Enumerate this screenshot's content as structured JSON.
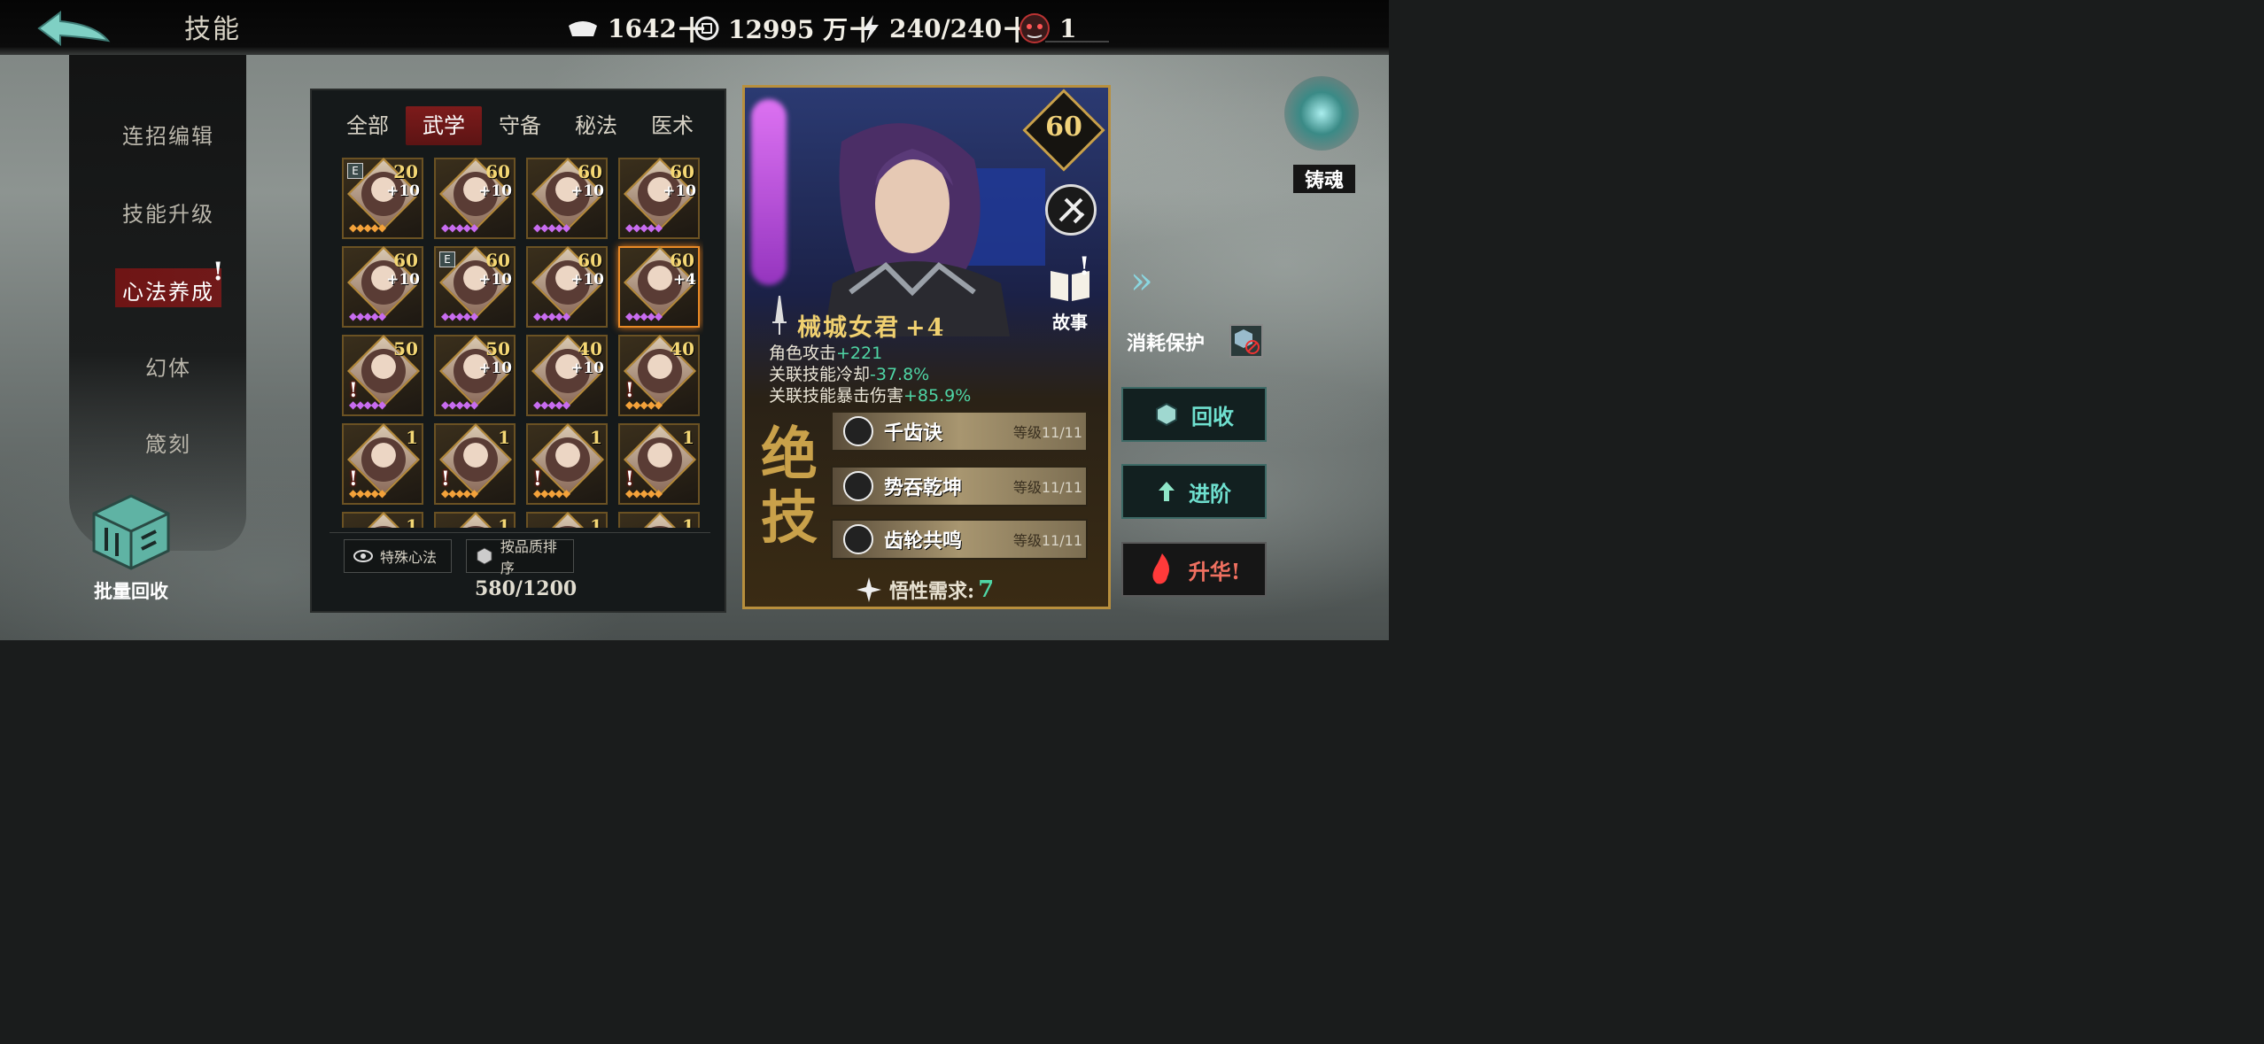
{
  "header": {
    "title": "技能",
    "resources": [
      {
        "icon": "silver-ingot-icon",
        "value": "1642",
        "plus": "十"
      },
      {
        "icon": "coin-icon",
        "value": "12995 万",
        "plus": "十"
      },
      {
        "icon": "lightning-icon",
        "value": "240/240",
        "plus": "十"
      },
      {
        "icon": "demon-mask-icon",
        "value": "1"
      }
    ]
  },
  "sidebar": {
    "items": [
      {
        "label": "连招编辑"
      },
      {
        "label": "技能升级"
      },
      {
        "label": "心法养成"
      },
      {
        "label": "幻体"
      },
      {
        "label": "箴刻"
      }
    ],
    "active_index": 2,
    "bulk_recycle": "批量回收"
  },
  "tabs": [
    "全部",
    "武学",
    "守备",
    "秘法",
    "医术"
  ],
  "active_tab": 1,
  "cards": [
    {
      "level": "20",
      "plus": "+10",
      "e": true,
      "gems": "gold"
    },
    {
      "level": "60",
      "plus": "+10",
      "gems": "purple"
    },
    {
      "level": "60",
      "plus": "+10",
      "gems": "purple"
    },
    {
      "level": "60",
      "plus": "+10",
      "gems": "purple"
    },
    {
      "level": "60",
      "plus": "+10",
      "gems": "purple"
    },
    {
      "level": "60",
      "plus": "+10",
      "e": true,
      "gems": "purple"
    },
    {
      "level": "60",
      "plus": "+10",
      "gems": "purple"
    },
    {
      "level": "60",
      "plus": "+4",
      "selected": true,
      "gems": "purple"
    },
    {
      "level": "50",
      "plus": "",
      "warn": true,
      "gems": "purple"
    },
    {
      "level": "50",
      "plus": "+10",
      "gems": "purple"
    },
    {
      "level": "40",
      "plus": "+10",
      "gems": "purple"
    },
    {
      "level": "40",
      "plus": "",
      "warn": true,
      "gems": "gold"
    },
    {
      "level": "1",
      "plus": "",
      "warn": true,
      "gems": "gold"
    },
    {
      "level": "1",
      "plus": "",
      "warn": true,
      "gems": "gold"
    },
    {
      "level": "1",
      "plus": "",
      "warn": true,
      "gems": "gold"
    },
    {
      "level": "1",
      "plus": "",
      "warn": true,
      "gems": "gold"
    },
    {
      "level": "1",
      "plus": "",
      "gems": "gold"
    },
    {
      "level": "1",
      "plus": "",
      "gems": "gold"
    },
    {
      "level": "1",
      "plus": "",
      "gems": "gold"
    },
    {
      "level": "1",
      "plus": "",
      "gems": "gold"
    }
  ],
  "grid_footer": {
    "special_label": "特殊心法",
    "sort_label": "按品质排序",
    "count": "580/1200"
  },
  "detail": {
    "level": "60",
    "name": "械城女君",
    "plus": "+4",
    "story": "故事",
    "stats": [
      {
        "label": "角色攻击",
        "value": "+221"
      },
      {
        "label": "关联技能冷却",
        "value": "-37.8%"
      },
      {
        "label": "关联技能暴击伤害",
        "value": "+85.9%"
      }
    ],
    "ult_title": "绝技",
    "skills": [
      {
        "name": "千齿诀",
        "level_label": "等级",
        "level": "11/11"
      },
      {
        "name": "势吞乾坤",
        "level_label": "等级",
        "level": "11/11"
      },
      {
        "name": "齿轮共鸣",
        "level_label": "等级",
        "level": "11/11"
      }
    ],
    "insight_label": "悟性需求:",
    "insight_value": "7"
  },
  "right": {
    "soul": "铸魂",
    "protect": "消耗保护",
    "recycle": "回收",
    "advance": "进阶",
    "ascend": "升华!"
  },
  "colors": {
    "accent_teal": "#4fd6a6",
    "gold": "#f0d070",
    "active_red": "#7d1b1b"
  }
}
